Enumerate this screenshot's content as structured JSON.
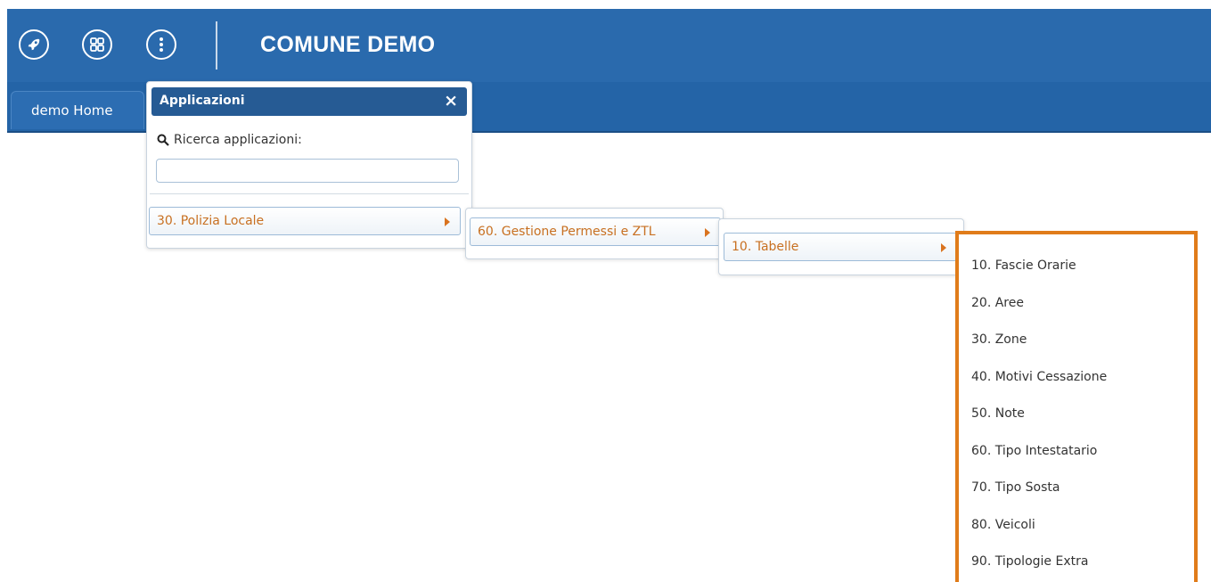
{
  "header": {
    "title": "COMUNE DEMO",
    "home_tab": "demo Home",
    "icons": [
      "rocket-icon",
      "grid-icon",
      "more-vertical-icon"
    ]
  },
  "apps_panel": {
    "title": "Applicazioni",
    "close": "×",
    "search_label": "Ricerca applicazioni:",
    "search_value": ""
  },
  "menu": {
    "level1": {
      "label": "30. Polizia Locale"
    },
    "level2": {
      "label": "60. Gestione Permessi e ZTL"
    },
    "level3": {
      "label": "10. Tabelle"
    },
    "items": [
      {
        "label": "10. Fascie Orarie"
      },
      {
        "label": "20. Aree"
      },
      {
        "label": "30. Zone"
      },
      {
        "label": "40. Motivi Cessazione"
      },
      {
        "label": "50. Note"
      },
      {
        "label": "60. Tipo Intestatario"
      },
      {
        "label": "70. Tipo Sosta"
      },
      {
        "label": "80. Veicoli"
      },
      {
        "label": "90. Tipologie Extra"
      }
    ]
  },
  "colors": {
    "header_blue": "#2a6aad",
    "accent_orange": "#e07c1a",
    "menu_text": "#c87021"
  }
}
